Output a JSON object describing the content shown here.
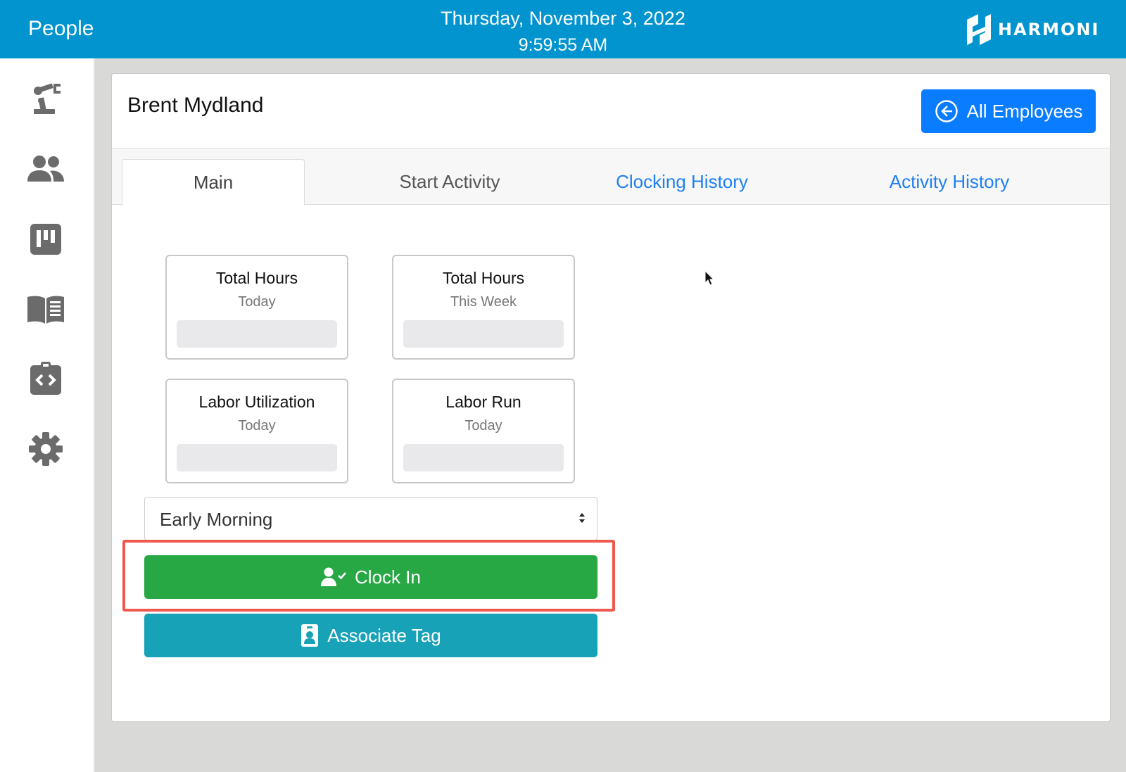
{
  "header": {
    "title": "People",
    "date": "Thursday, November 3, 2022",
    "time": "9:59:55 AM",
    "logo_text": "HARMONI",
    "background": "#0194ce"
  },
  "sidebar": {
    "items": [
      {
        "icon": "robot-arm-icon"
      },
      {
        "icon": "people-icon"
      },
      {
        "icon": "board-icon"
      },
      {
        "icon": "book-icon"
      },
      {
        "icon": "badge-code-icon"
      },
      {
        "icon": "gear-icon"
      }
    ]
  },
  "main": {
    "person_name": "Brent Mydland",
    "all_employees_label": "All Employees",
    "tabs": [
      {
        "label": "Main",
        "active": true
      },
      {
        "label": "Start Activity"
      },
      {
        "label": "Clocking History"
      },
      {
        "label": "Activity History"
      }
    ],
    "stats": [
      {
        "title": "Total Hours",
        "subtitle": "Today"
      },
      {
        "title": "Total Hours",
        "subtitle": "This Week"
      },
      {
        "title": "Labor Utilization",
        "subtitle": "Today"
      },
      {
        "title": "Labor Run",
        "subtitle": "Today"
      }
    ],
    "shift_select": {
      "value": "Early Morning"
    },
    "clock_in_label": "Clock In",
    "associate_tag_label": "Associate Tag",
    "colors": {
      "primary": "#0a7cff",
      "success": "#28a745",
      "info": "#17a2b8",
      "highlight": "#ee5a4f"
    }
  }
}
